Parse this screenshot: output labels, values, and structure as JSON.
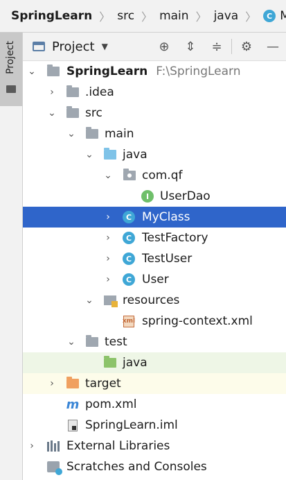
{
  "breadcrumb": {
    "items": [
      "SpringLearn",
      "src",
      "main",
      "java",
      "MyClas"
    ]
  },
  "side_tab": {
    "label": "Project"
  },
  "panel": {
    "title": "Project"
  },
  "tree": [
    {
      "label": "SpringLearn",
      "hint": "F:\\SpringLearn"
    },
    {
      "label": ".idea"
    },
    {
      "label": "src"
    },
    {
      "label": "main"
    },
    {
      "label": "java"
    },
    {
      "label": "com.qf"
    },
    {
      "label": "UserDao",
      "badge": "I"
    },
    {
      "label": "MyClass",
      "badge": "C"
    },
    {
      "label": "TestFactory",
      "badge": "C"
    },
    {
      "label": "TestUser",
      "badge": "C"
    },
    {
      "label": "User",
      "badge": "C"
    },
    {
      "label": "resources"
    },
    {
      "label": "spring-context.xml",
      "badge": "xml"
    },
    {
      "label": "test"
    },
    {
      "label": "java"
    },
    {
      "label": "target"
    },
    {
      "label": "pom.xml",
      "badge": "m"
    },
    {
      "label": "SpringLearn.iml"
    },
    {
      "label": "External Libraries"
    },
    {
      "label": "Scratches and Consoles"
    }
  ],
  "colors": {
    "selection": "#2f65ca",
    "class_icon": "#3fa7d6",
    "interface_icon": "#6fbf6a"
  }
}
